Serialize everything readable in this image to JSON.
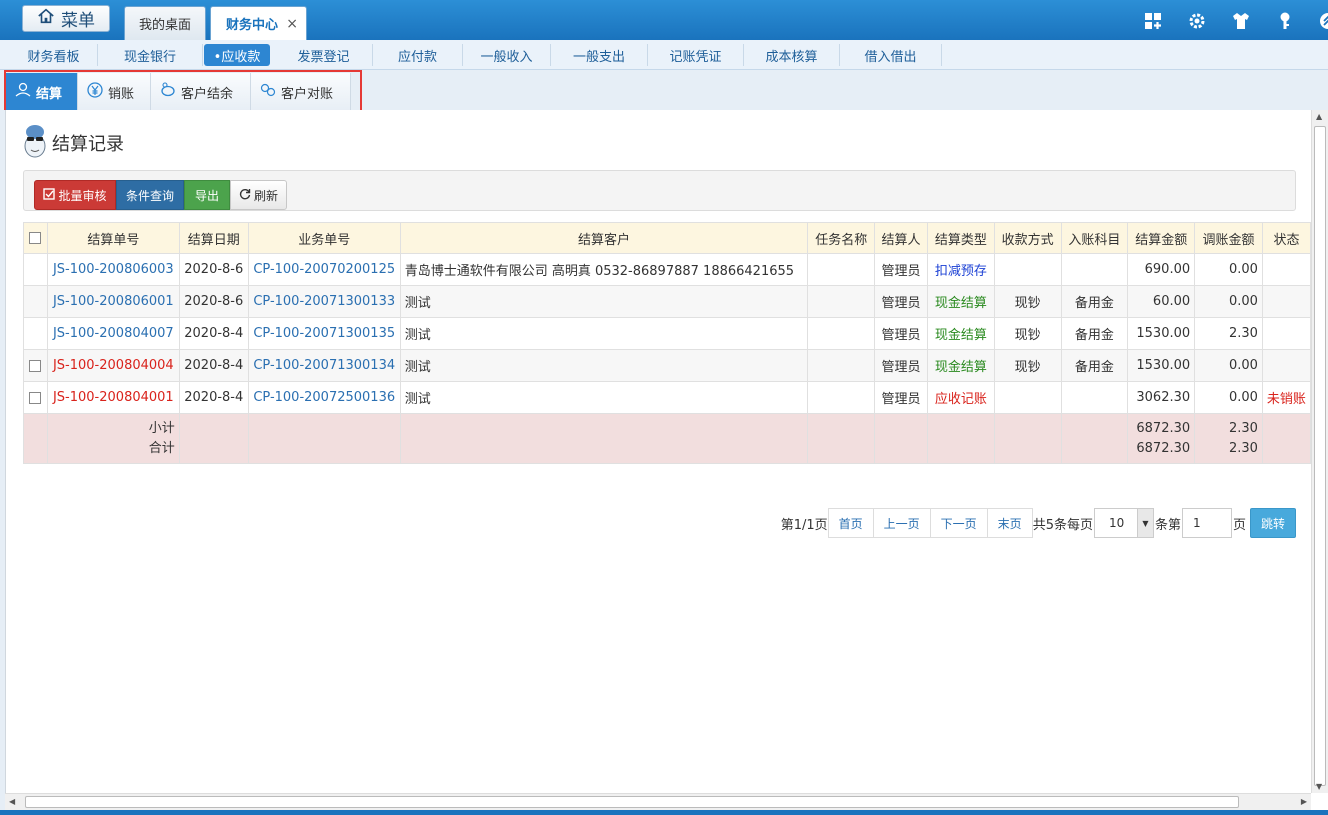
{
  "header": {
    "menu_label": "菜单",
    "tabs": [
      {
        "label": "我的桌面"
      },
      {
        "label": "财务中心"
      }
    ],
    "close_label": "×"
  },
  "nav": {
    "items": [
      "财务看板",
      "现金银行",
      "•应收款",
      "发票登记",
      "应付款",
      "一般收入",
      "一般支出",
      "记账凭证",
      "成本核算",
      "借入借出"
    ]
  },
  "subtabs": [
    "结算",
    "销账",
    "客户结余",
    "客户对账"
  ],
  "page_title": "结算记录",
  "toolbar": {
    "audit": "批量审核",
    "query": "条件查询",
    "export": "导出",
    "refresh": "刷新"
  },
  "table": {
    "headers": [
      "结算单号",
      "结算日期",
      "业务单号",
      "结算客户",
      "任务名称",
      "结算人",
      "结算类型",
      "收款方式",
      "入账科目",
      "结算金额",
      "调账金额",
      "状态"
    ],
    "rows": [
      {
        "no": "JS-100-200806003",
        "date": "2020-8-6",
        "biz": "CP-100-20070200125",
        "customer": "青岛博士通软件有限公司 高明真 0532-86897887 18866421655",
        "task": "",
        "person": "管理员",
        "type": "扣减预存",
        "pay": "",
        "account": "",
        "amount": "690.00",
        "adjust": "0.00",
        "status": ""
      },
      {
        "no": "JS-100-200806001",
        "date": "2020-8-6",
        "biz": "CP-100-20071300133",
        "customer": "测试",
        "task": "",
        "person": "管理员",
        "type": "现金结算",
        "pay": "现钞",
        "account": "备用金",
        "amount": "60.00",
        "adjust": "0.00",
        "status": ""
      },
      {
        "no": "JS-100-200804007",
        "date": "2020-8-4",
        "biz": "CP-100-20071300135",
        "customer": "测试",
        "task": "",
        "person": "管理员",
        "type": "现金结算",
        "pay": "现钞",
        "account": "备用金",
        "amount": "1530.00",
        "adjust": "2.30",
        "status": ""
      },
      {
        "no": "JS-100-200804004",
        "date": "2020-8-4",
        "biz": "CP-100-20071300134",
        "customer": "测试",
        "task": "",
        "person": "管理员",
        "type": "现金结算",
        "pay": "现钞",
        "account": "备用金",
        "amount": "1530.00",
        "adjust": "0.00",
        "status": ""
      },
      {
        "no": "JS-100-200804001",
        "date": "2020-8-4",
        "biz": "CP-100-20072500136",
        "customer": "测试",
        "task": "",
        "person": "管理员",
        "type": "应收记账",
        "pay": "",
        "account": "",
        "amount": "3062.30",
        "adjust": "0.00",
        "status": "未销账"
      }
    ],
    "subtotal_label": "小计",
    "total_label": "合计",
    "subtotal_amount": "6872.30",
    "subtotal_adjust": "2.30",
    "total_amount": "6872.30",
    "total_adjust": "2.30"
  },
  "pager": {
    "page_info": "第1/1页",
    "first": "首页",
    "prev": "上一页",
    "next": "下一页",
    "last": "末页",
    "total_per": "共5条每页",
    "page_size": "10",
    "unit_go": "条第",
    "page_input": "1",
    "page_suffix": "页",
    "go": "跳转"
  },
  "colors": {
    "link": "#2a6fb1",
    "red": "#d9231c",
    "green": "#2a8a1f",
    "blue": "#1a3fd4",
    "accent": "#2d86d2"
  }
}
